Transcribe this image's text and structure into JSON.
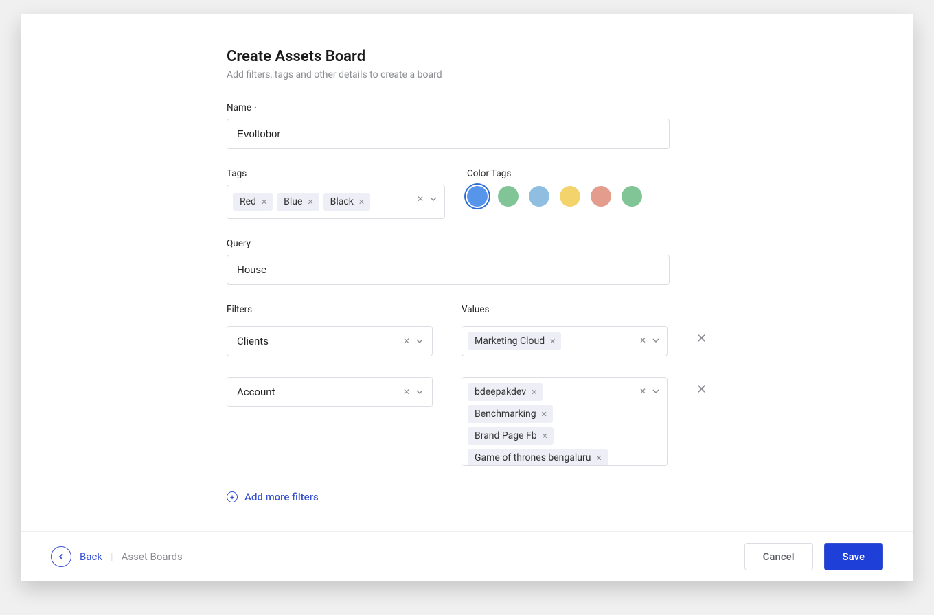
{
  "header": {
    "title": "Create Assets Board",
    "subtitle": "Add filters, tags and other details to create a board"
  },
  "fields": {
    "name": {
      "label": "Name",
      "value": "Evoltobor",
      "required": true
    },
    "tags": {
      "label": "Tags",
      "values": [
        "Red",
        "Blue",
        "Black"
      ]
    },
    "color_tags": {
      "label": "Color Tags",
      "options": [
        {
          "color": "#5695ea",
          "selected": true
        },
        {
          "color": "#81c596",
          "selected": false
        },
        {
          "color": "#8fbee1",
          "selected": false
        },
        {
          "color": "#f3d36c",
          "selected": false
        },
        {
          "color": "#e49c8c",
          "selected": false
        },
        {
          "color": "#81c596",
          "selected": false
        }
      ]
    },
    "query": {
      "label": "Query",
      "value": "House"
    }
  },
  "filters": {
    "filter_header": "Filters",
    "values_header": "Values",
    "rows": [
      {
        "filter": "Clients",
        "values": [
          "Marketing Cloud"
        ]
      },
      {
        "filter": "Account",
        "values": [
          "bdeepakdev",
          "Benchmarking",
          "Brand Page Fb",
          "Game of thrones bengaluru"
        ]
      }
    ],
    "add_more_label": "Add more filters"
  },
  "footer": {
    "back": "Back",
    "breadcrumb": "Asset Boards",
    "cancel": "Cancel",
    "save": "Save"
  }
}
